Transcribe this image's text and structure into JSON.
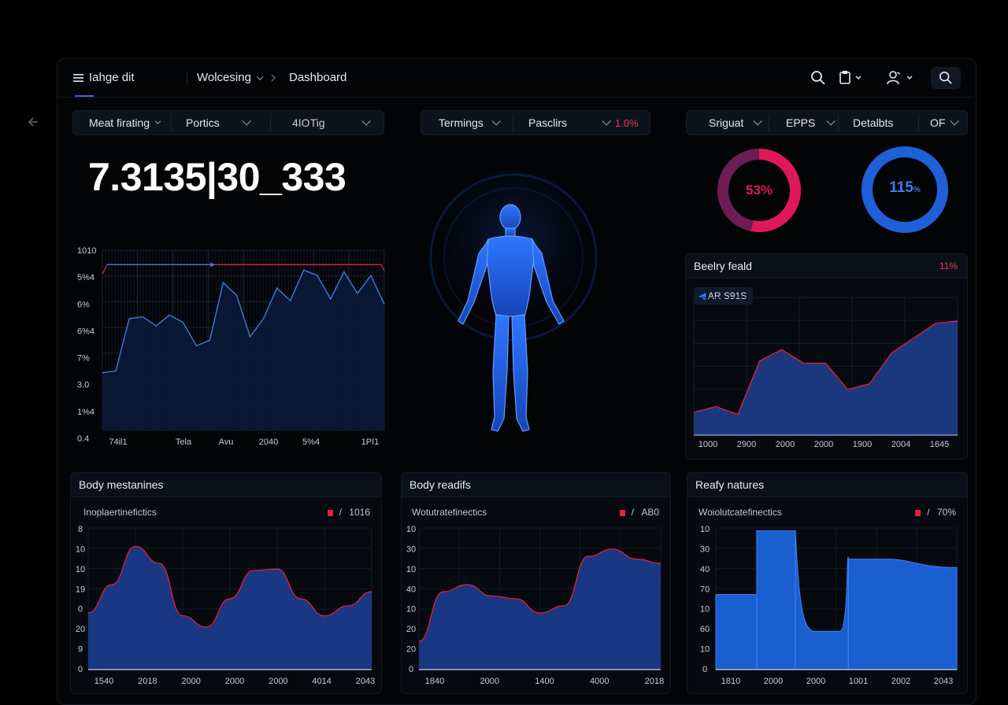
{
  "header": {
    "menu_label": "Iahge dit",
    "breadcrumb_parent": "Wolcesing",
    "breadcrumb_current": "Dashboard"
  },
  "filters_left": [
    "Meat firating",
    "Portics",
    "4IOTig"
  ],
  "filters_mid": {
    "items": [
      "Termings",
      "Pasclirs"
    ],
    "value": "1.0%"
  },
  "filters_right": [
    "Sriguat",
    "EPPS",
    "Detalbts",
    "OF"
  ],
  "metric": {
    "value": "7.3135|30_333"
  },
  "rings": [
    {
      "label": "53%",
      "fraction": 0.53,
      "color": "#e0185a"
    },
    {
      "label": "115",
      "sub": "%",
      "fraction": 1.0,
      "color": "#1f5fd8"
    }
  ],
  "colors": {
    "red_accent": "#e2203f",
    "blue_fill": "#1e3f8f",
    "bright_blue": "#1a5fd0"
  },
  "chart_data": [
    {
      "type": "area",
      "title": "",
      "y_tick_labels": [
        "1010",
        "5%4",
        "6%",
        "6%4",
        "7%",
        "3.0",
        "1%4",
        "0.4"
      ],
      "x_tick_labels": [
        "74il1",
        "Tela",
        "Avu",
        "2040",
        "5%4",
        "1PI1"
      ],
      "series": [
        {
          "color": "#3a7be0",
          "values": [
            0.32,
            0.33,
            0.62,
            0.63,
            0.58,
            0.64,
            0.6,
            0.47,
            0.5,
            0.82,
            0.75,
            0.52,
            0.62,
            0.79,
            0.72,
            0.89,
            0.86,
            0.73,
            0.88,
            0.76,
            0.86,
            0.7
          ]
        },
        {
          "name": "threshold",
          "color": "#d9263f",
          "values": [
            0.92
          ]
        }
      ]
    },
    {
      "type": "area",
      "title": "Beelry feald",
      "badge": "11%",
      "chip": "AR S91S",
      "x_tick_labels": [
        "1000",
        "2900",
        "2000",
        "2000",
        "1900",
        "2004",
        "1645"
      ],
      "values": [
        0.2,
        0.25,
        0.18,
        0.65,
        0.75,
        0.63,
        0.63,
        0.4,
        0.45,
        0.72,
        0.85,
        0.98,
        1.0
      ]
    },
    {
      "type": "area",
      "title": "Body mestanines",
      "subtitle": "Inoplaertinefictics",
      "legend_value": "1016",
      "y_tick_labels": [
        "8",
        "10",
        "10",
        "19",
        "0",
        "20",
        "9",
        "0"
      ],
      "x_tick_labels": [
        "1540",
        "2018",
        "2000",
        "2000",
        "2000",
        "4014",
        "2043"
      ],
      "values": [
        0.4,
        0.6,
        0.87,
        0.75,
        0.38,
        0.3,
        0.5,
        0.7,
        0.71,
        0.5,
        0.38,
        0.45,
        0.55
      ]
    },
    {
      "type": "area",
      "title": "Body readifs",
      "subtitle": "Wotutratefinectics",
      "legend_value": "AB0",
      "y_tick_labels": [
        "10",
        "30",
        "10",
        "40",
        "10",
        "20",
        "20",
        "0"
      ],
      "x_tick_labels": [
        "1840",
        "2000",
        "1400",
        "4000",
        "2018"
      ],
      "values": [
        0.2,
        0.55,
        0.6,
        0.52,
        0.5,
        0.4,
        0.45,
        0.8,
        0.85,
        0.78,
        0.75
      ]
    },
    {
      "type": "bar",
      "title": "Reafy natures",
      "subtitle": "Woiolutcatefinectics",
      "legend_value": "70%",
      "y_tick_labels": [
        "10",
        "30",
        "40",
        "70",
        "10",
        "60",
        "10",
        "0"
      ],
      "x_tick_labels": [
        "1810",
        "2000",
        "2000",
        "1001",
        "2002",
        "2043"
      ],
      "values": [
        0.53,
        0.98,
        0.27,
        0.78,
        0.72
      ]
    }
  ]
}
